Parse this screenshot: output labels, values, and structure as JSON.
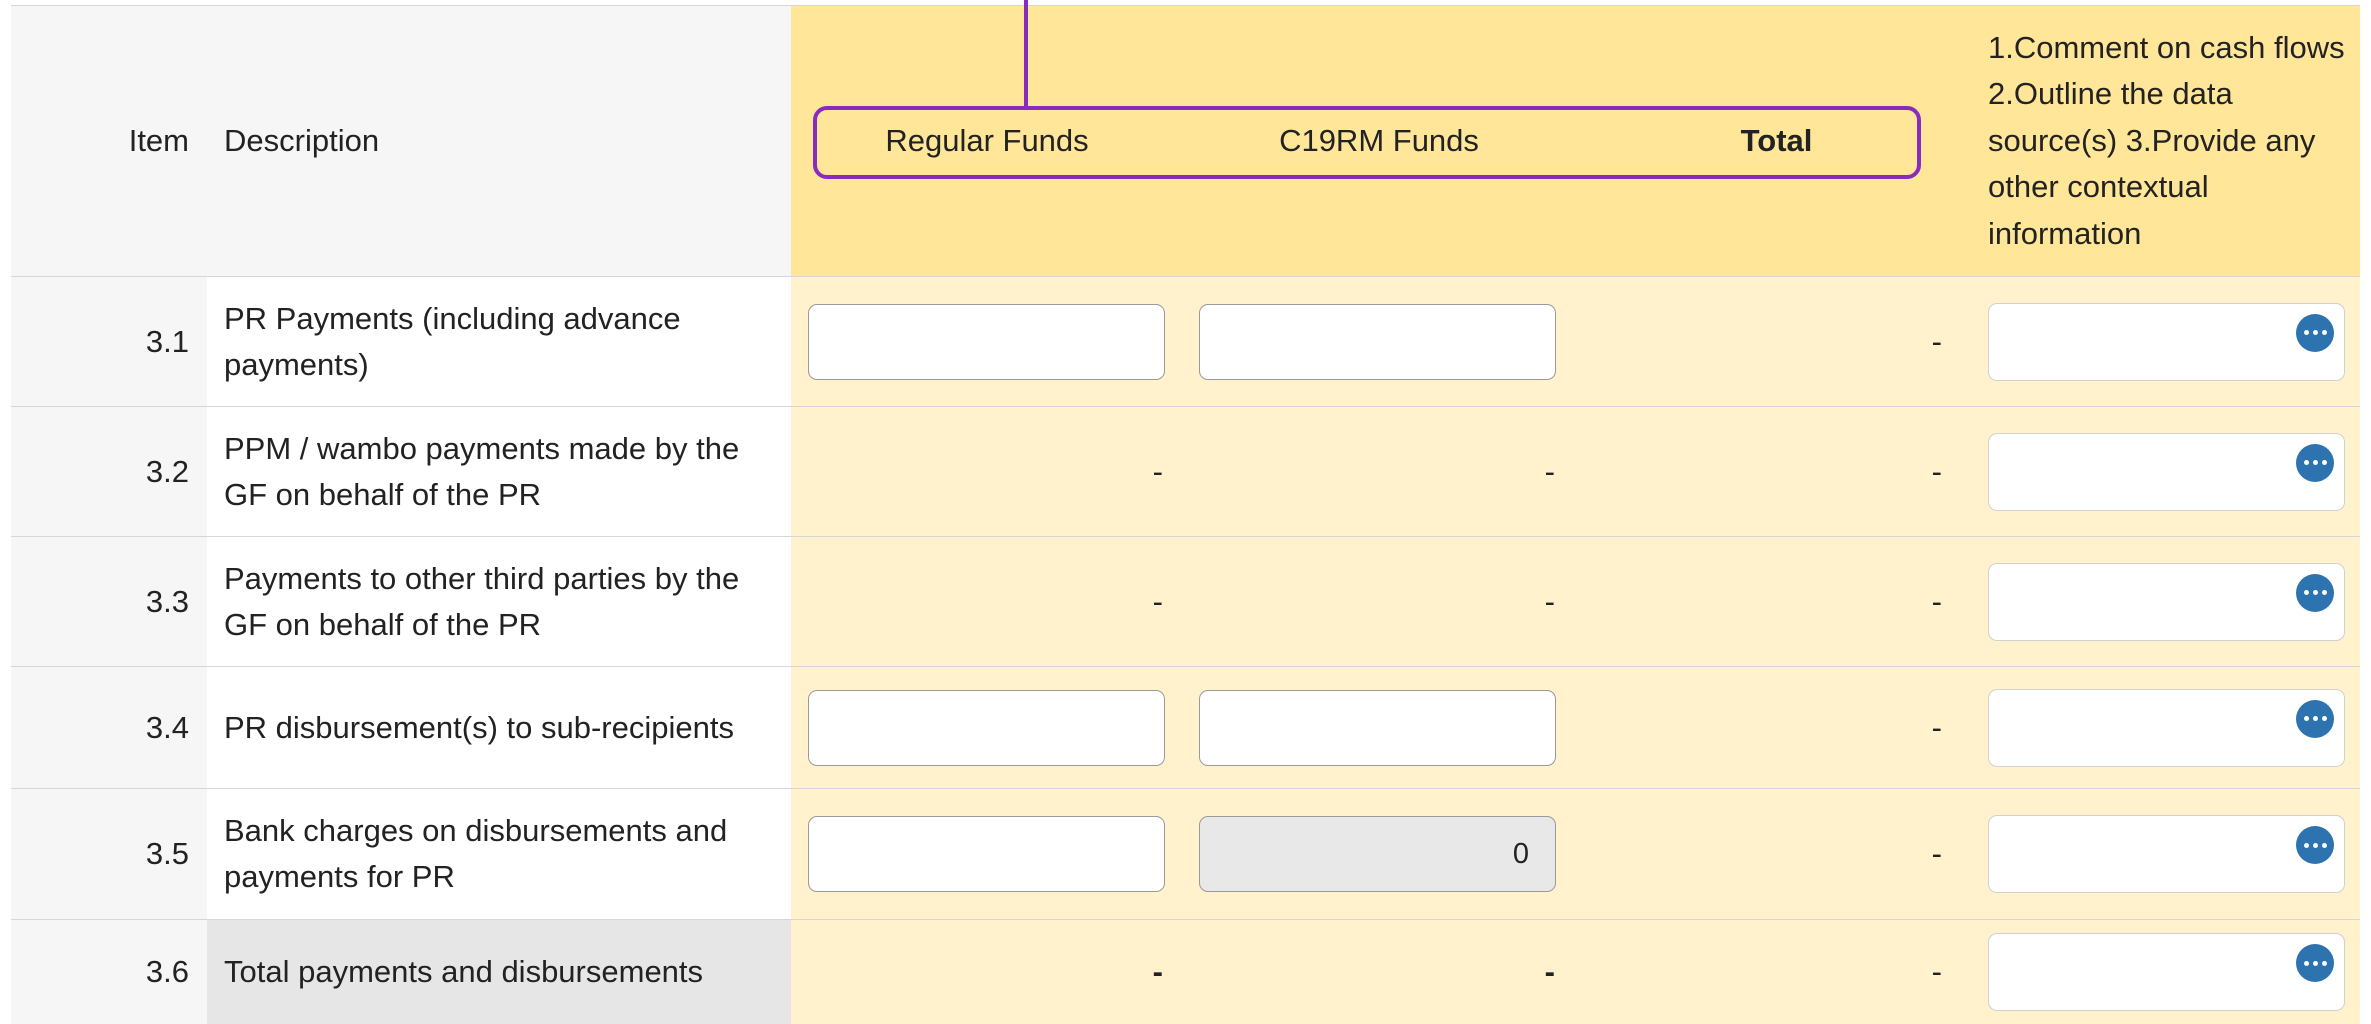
{
  "header": {
    "item": "Item",
    "description": "Description",
    "regular": "Regular Funds",
    "c19rm": "C19RM Funds",
    "total": "Total",
    "comment": "1.Comment on cash flows 2.Outline the data source(s) 3.Provide any other contextual information"
  },
  "rows": [
    {
      "item": "3.1",
      "description": "PR Payments (including advance payments)",
      "regular": {
        "type": "input",
        "value": ""
      },
      "c19rm": {
        "type": "input",
        "value": ""
      },
      "total": "-"
    },
    {
      "item": "3.2",
      "description": "PPM / wambo payments made by the GF on behalf of the PR",
      "regular": {
        "type": "text",
        "value": "-"
      },
      "c19rm": {
        "type": "text",
        "value": "-"
      },
      "total": "-"
    },
    {
      "item": "3.3",
      "description": "Payments to other third parties by the GF on behalf of the PR",
      "regular": {
        "type": "text",
        "value": "-"
      },
      "c19rm": {
        "type": "text",
        "value": "-"
      },
      "total": "-"
    },
    {
      "item": "3.4",
      "description": "PR disbursement(s) to sub-recipients",
      "regular": {
        "type": "input",
        "value": ""
      },
      "c19rm": {
        "type": "input",
        "value": ""
      },
      "total": "-"
    },
    {
      "item": "3.5",
      "description": "Bank charges on disbursements and payments for PR",
      "regular": {
        "type": "input",
        "value": ""
      },
      "c19rm": {
        "type": "input-disabled",
        "value": "0"
      },
      "total": "-"
    },
    {
      "item": "3.6",
      "description": "Total payments and disbursements",
      "regular": {
        "type": "text",
        "value": "-"
      },
      "c19rm": {
        "type": "text",
        "value": "-"
      },
      "total": "-"
    }
  ],
  "icons": {
    "comment_button": "more-horizontal-icon"
  },
  "colors": {
    "highlight": "#8a2bbf",
    "header_yellow": "#ffe699",
    "cell_yellow": "#fff2cc",
    "button_blue": "#2c73b0"
  }
}
